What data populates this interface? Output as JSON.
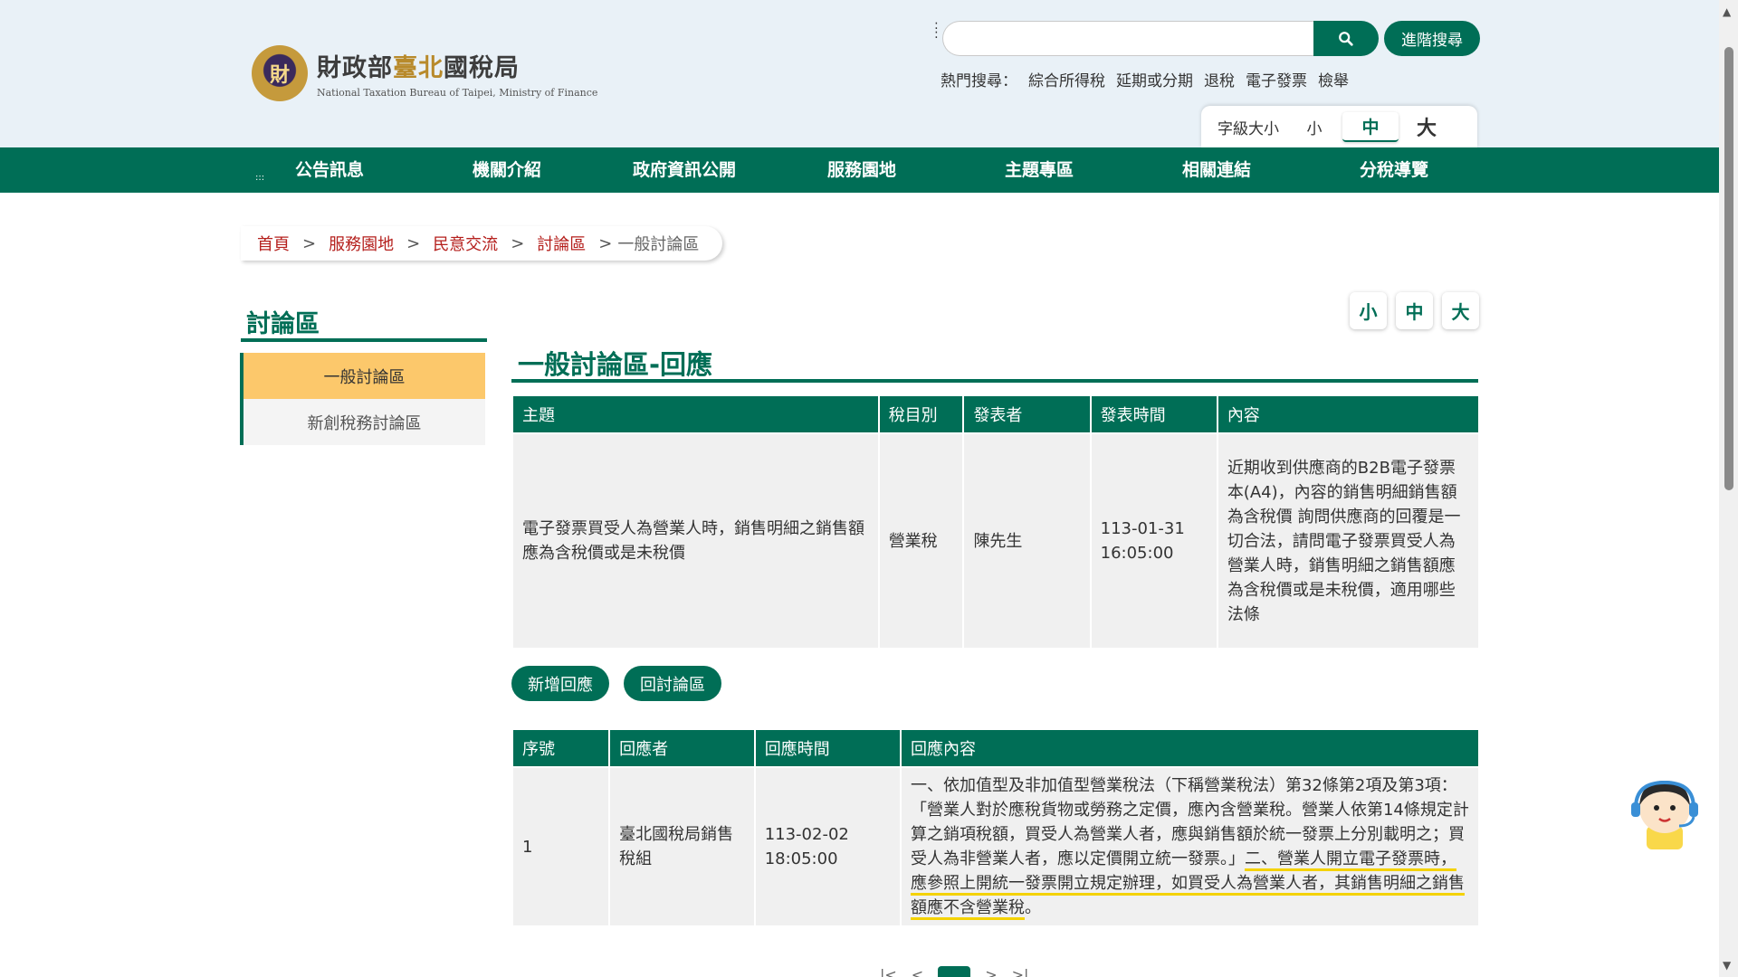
{
  "header": {
    "logo_zh_prefix": "財政部",
    "logo_zh_accent": "臺北",
    "logo_zh_suffix": "國稅局",
    "logo_en": "National Taxation Bureau of Taipei, Ministry of Finance",
    "logo_emblem_text": "財",
    "search": {
      "placeholder": "",
      "value": ""
    },
    "advanced_search_label": "進階搜尋",
    "hot_search_label": "熱門搜尋：",
    "hot_search_items": [
      "綜合所得稅",
      "延期或分期",
      "退稅",
      "電子發票",
      "檢舉"
    ],
    "font_size_label": "字級大小",
    "font_size_options": [
      "小",
      "中",
      "大"
    ],
    "font_size_selected": "中"
  },
  "nav": {
    "items": [
      "公告訊息",
      "機關介紹",
      "政府資訊公開",
      "服務園地",
      "主題專區",
      "相關連結",
      "分稅導覽"
    ]
  },
  "breadcrumb": {
    "items": [
      "首頁",
      "服務園地",
      "民意交流",
      "討論區"
    ],
    "current": "一般討論區",
    "separator": ">"
  },
  "sidebar": {
    "title": "討論區",
    "items": [
      {
        "label": "一般討論區",
        "active": true
      },
      {
        "label": "新創稅務討論區",
        "active": false
      }
    ]
  },
  "content_font_buttons": [
    "小",
    "中",
    "大"
  ],
  "main": {
    "title": "一般討論區-回應",
    "topic_table": {
      "headers": [
        "主題",
        "稅目別",
        "發表者",
        "發表時間",
        "內容"
      ],
      "row": {
        "subject": "電子發票買受人為營業人時，銷售明細之銷售額應為含稅價或是未稅價",
        "tax_type": "營業稅",
        "author": "陳先生",
        "date": "113-01-31",
        "time": "16:05:00",
        "content": "近期收到供應商的B2B電子發票本(A4)，內容的銷售明細銷售額為含稅價 詢問供應商的回覆是一切合法，請問電子發票買受人為營業人時，銷售明細之銷售額應為含稅價或是未稅價，適用哪些法條"
      }
    },
    "buttons": {
      "add_reply": "新增回應",
      "back": "回討論區"
    },
    "reply_table": {
      "headers": [
        "序號",
        "回應者",
        "回應時間",
        "回應內容"
      ],
      "row": {
        "no": "1",
        "responder": "臺北國稅局銷售稅組",
        "date": "113-02-02",
        "time": "18:05:00",
        "content_plain": "一、依加值型及非加值型營業稅法（下稱營業稅法）第32條第2項及第3項：「營業人對於應稅貨物或勞務之定價，應內含營業稅。營業人依第14條規定計算之銷項稅額，買受人為營業人者，應與銷售額於統一發票上分別載明之；買受人為非營業人者，應以定價開立統一發票。」",
        "content_highlight": "二、營業人開立電子發票時，應參照上開統一發票開立規定辦理，如買受人為營業人者，其銷售明細之銷售額應不含營業稅",
        "content_end": "。"
      }
    }
  },
  "colors": {
    "primary": "#006e56",
    "active_menu": "#fcc86b",
    "link_red": "#b5201d",
    "header_bg": "#e9f1f7",
    "highlight": "#f4d200"
  }
}
